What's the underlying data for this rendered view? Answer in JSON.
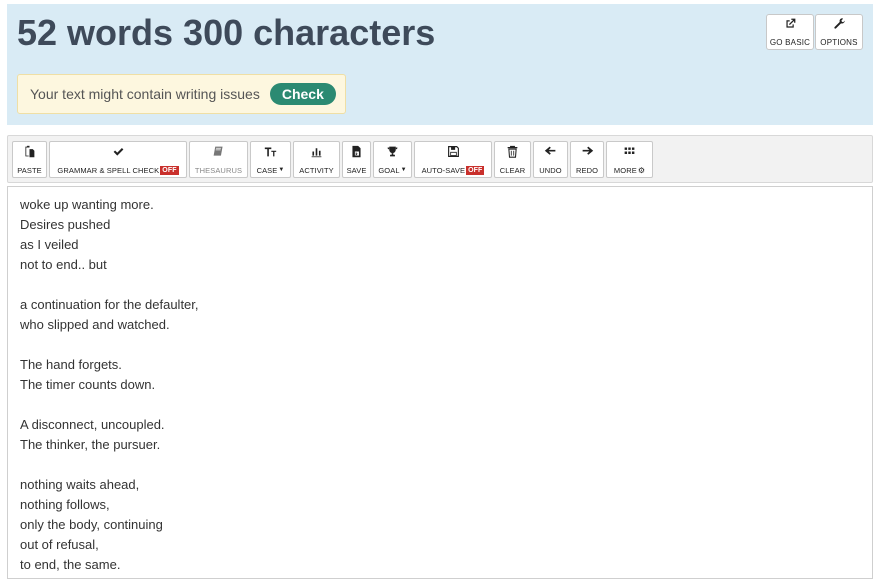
{
  "header": {
    "title": "52 words 300 characters",
    "go_basic_label": "GO BASIC",
    "options_label": "OPTIONS"
  },
  "issue_bar": {
    "message": "Your text might contain writing issues",
    "check_label": "Check"
  },
  "toolbar": {
    "paste": "PASTE",
    "grammar": "GRAMMAR & SPELL CHECK",
    "grammar_status": "OFF",
    "thesaurus": "THESAURUS",
    "case": "CASE",
    "activity": "ACTIVITY",
    "save": "SAVE",
    "goal": "GOAL",
    "autosave": "AUTO-SAVE",
    "autosave_status": "OFF",
    "clear": "CLEAR",
    "undo": "UNDO",
    "redo": "REDO",
    "more": "MORE"
  },
  "editor": {
    "lines": [
      "woke up wanting more.",
      "Desires pushed",
      "as I veiled",
      "not to end.. but",
      "",
      "a continuation for the defaulter,",
      "who slipped and watched.",
      "",
      "The hand forgets.",
      "The timer counts down.",
      "",
      "A disconnect, uncoupled.",
      "The thinker, the pursuer.",
      "",
      "nothing waits ahead,",
      "nothing follows,",
      "only the body, continuing",
      "out of refusal,",
      "to end, the same."
    ]
  },
  "colors": {
    "header_bg": "#d9ebf5",
    "title": "#3e4a5a",
    "check_button": "#2b8a72",
    "off_badge": "#c9302c",
    "issue_bg": "#fdf7df"
  }
}
